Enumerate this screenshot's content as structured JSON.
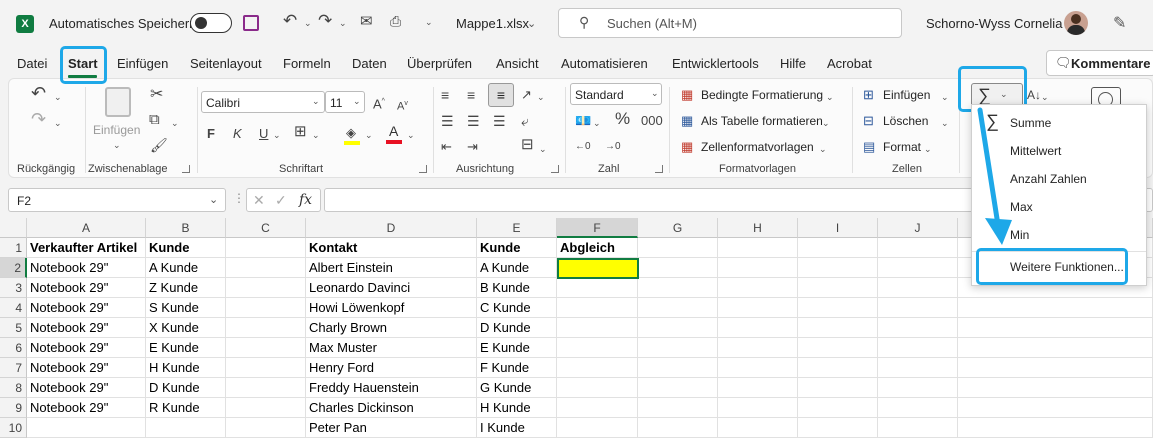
{
  "titlebar": {
    "autosave_label": "Automatisches Speichern",
    "filename": "Mappe1.xlsx",
    "search_placeholder": "Suchen (Alt+M)",
    "user_name": "Schorno-Wyss Cornelia"
  },
  "menu": {
    "items": [
      "Datei",
      "Start",
      "Einfügen",
      "Seitenlayout",
      "Formeln",
      "Daten",
      "Überprüfen",
      "Ansicht",
      "Automatisieren",
      "Entwicklertools",
      "Hilfe",
      "Acrobat"
    ],
    "comments_button": "Kommentare"
  },
  "ribbon": {
    "undo_group": "Rückgängig",
    "clipboard_group": "Zwischenablage",
    "paste_label": "Einfügen",
    "font_group": "Schriftart",
    "font_name": "Calibri",
    "font_size": "11",
    "bold": "F",
    "italic": "K",
    "underline": "U",
    "alignment_group": "Ausrichtung",
    "number_group": "Zahl",
    "number_format": "Standard",
    "styles_group": "Formatvorlagen",
    "conditional_format": "Bedingte Formatierung",
    "format_as_table": "Als Tabelle formatieren",
    "cell_styles": "Zellenformatvorlagen",
    "cells_group": "Zellen",
    "insert": "Einfügen",
    "delete": "Löschen",
    "format": "Format"
  },
  "formulabar": {
    "name_box": "F2",
    "fx": "fx"
  },
  "autosum_menu": {
    "items": [
      "Summe",
      "Mittelwert",
      "Anzahl Zahlen",
      "Max",
      "Min"
    ],
    "more": "Weitere Funktionen..."
  },
  "sheet": {
    "columns": [
      "A",
      "B",
      "C",
      "D",
      "E",
      "F",
      "G",
      "H",
      "I",
      "J"
    ],
    "rows": [
      {
        "num": "1",
        "A": "Verkaufter Artikel",
        "B": "Kunde",
        "C": "",
        "D": "Kontakt",
        "E": "Kunde",
        "F": "Abgleich"
      },
      {
        "num": "2",
        "A": "Notebook 29\"",
        "B": "A Kunde",
        "C": "",
        "D": "Albert Einstein",
        "E": "A Kunde",
        "F": ""
      },
      {
        "num": "3",
        "A": "Notebook 29\"",
        "B": "Z Kunde",
        "C": "",
        "D": "Leonardo Davinci",
        "E": "B Kunde",
        "F": ""
      },
      {
        "num": "4",
        "A": "Notebook 29\"",
        "B": "S Kunde",
        "C": "",
        "D": "Howi Löwenkopf",
        "E": "C Kunde",
        "F": ""
      },
      {
        "num": "5",
        "A": "Notebook 29\"",
        "B": "X Kunde",
        "C": "",
        "D": "Charly Brown",
        "E": "D Kunde",
        "F": ""
      },
      {
        "num": "6",
        "A": "Notebook 29\"",
        "B": "E Kunde",
        "C": "",
        "D": "Max Muster",
        "E": "E Kunde",
        "F": ""
      },
      {
        "num": "7",
        "A": "Notebook 29\"",
        "B": "H Kunde",
        "C": "",
        "D": "Henry Ford",
        "E": "F Kunde",
        "F": ""
      },
      {
        "num": "8",
        "A": "Notebook 29\"",
        "B": "D Kunde",
        "C": "",
        "D": "Freddy Hauenstein",
        "E": "G Kunde",
        "F": ""
      },
      {
        "num": "9",
        "A": "Notebook 29\"",
        "B": "R Kunde",
        "C": "",
        "D": "Charles Dickinson",
        "E": "H Kunde",
        "F": ""
      },
      {
        "num": "10",
        "A": "",
        "B": "",
        "C": "",
        "D": "Peter Pan",
        "E": "I Kunde",
        "F": ""
      }
    ]
  },
  "colors": {
    "accent": "#1ea8e8",
    "excel_green": "#107c41",
    "selection_fill": "#ffff00"
  }
}
